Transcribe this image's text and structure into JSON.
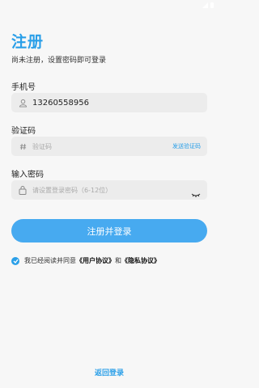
{
  "header": {
    "title": "注册",
    "subtitle": "尚未注册，设置密码即可登录"
  },
  "phone": {
    "label": "手机号",
    "value": "13260558956"
  },
  "code": {
    "label": "验证码",
    "placeholder": "验证码",
    "send_label": "发送验证码"
  },
  "password": {
    "label": "输入密码",
    "placeholder": "请设置登录密码（6-12位）"
  },
  "submit_label": "注册并登录",
  "agreement": {
    "prefix": "我已经阅读并同意",
    "user_agreement": "《用户协议》",
    "conjunction": "和",
    "privacy_agreement": "《隐私协议》",
    "checked": true
  },
  "back_label": "返回登录",
  "colors": {
    "accent": "#2a9fe8",
    "button": "#47aaf0",
    "field_bg": "#ececec"
  }
}
